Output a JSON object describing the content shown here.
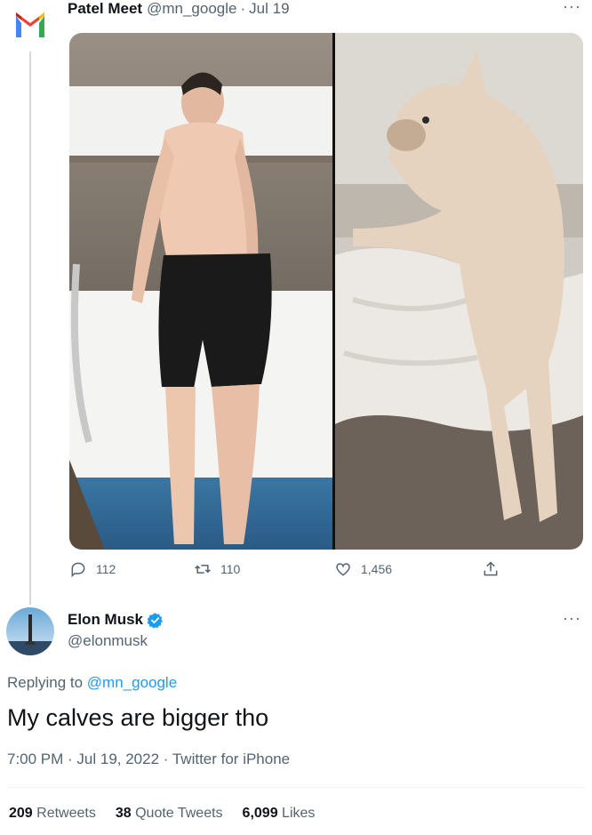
{
  "parent_tweet": {
    "author_name": "Patel Meet",
    "handle": "@mn_google",
    "separator": "·",
    "date": "Jul 19",
    "more": "···",
    "stats": {
      "replies": "112",
      "retweets": "110",
      "likes": "1,456"
    }
  },
  "reply_tweet": {
    "author_name": "Elon Musk",
    "handle": "@elonmusk",
    "more": "···",
    "replying_prefix": "Replying to ",
    "replying_to": "@mn_google",
    "text": "My calves are bigger tho",
    "meta": "7:00 PM · Jul 19, 2022 · Twitter for iPhone",
    "retweets_count": "209",
    "retweets_label": "Retweets",
    "quote_count": "38",
    "quote_label": "Quote Tweets",
    "likes_count": "6,099",
    "likes_label": "Likes"
  },
  "colors": {
    "accent": "#1d9bf0",
    "secondary_text": "#536471",
    "primary_text": "#0f1419"
  }
}
